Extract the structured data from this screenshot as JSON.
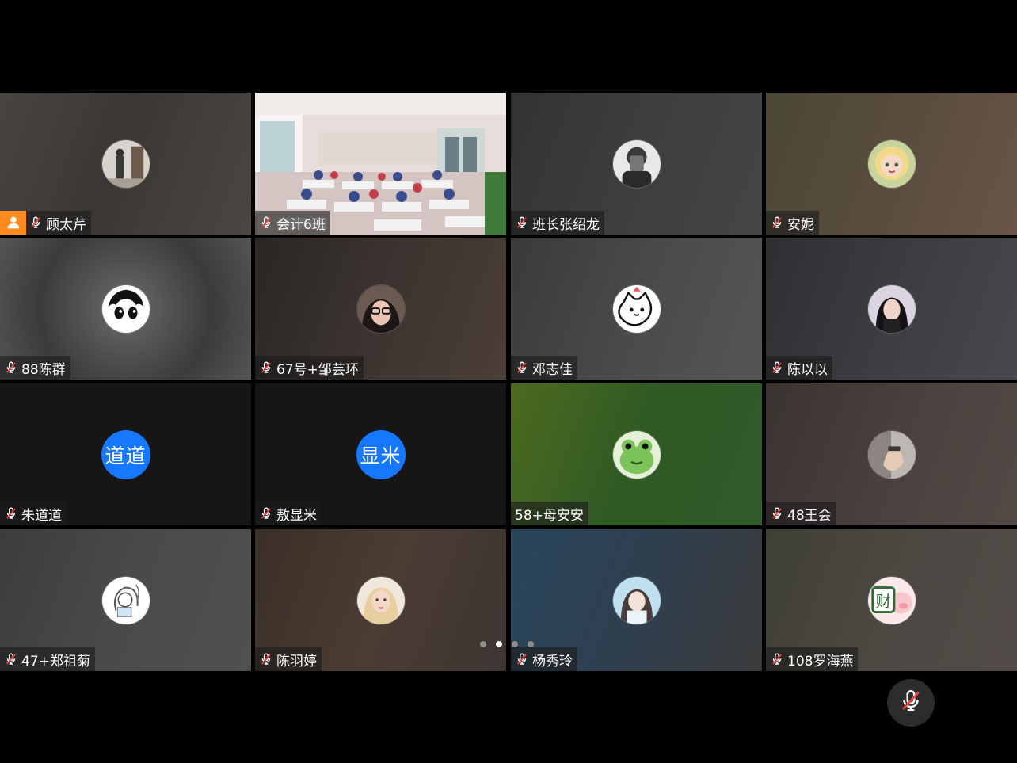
{
  "app": {
    "colors": {
      "host_badge": "#ff8a1f",
      "text_avatar": "#1677ff",
      "mute_slash": "#e8453c"
    }
  },
  "grid": {
    "participants": [
      {
        "name": "顾太芹",
        "muted": true,
        "host": true,
        "avatar_type": "photo",
        "avatar_icon": "person-photo-icon",
        "bg": "linear-gradient(110deg,#4a443f 0%,#3a3734 45%,#4c4641 100%)"
      },
      {
        "name": "会计6班",
        "muted": true,
        "host": false,
        "avatar_type": "video",
        "avatar_icon": "classroom-video-icon",
        "bg": ""
      },
      {
        "name": "班长张绍龙",
        "muted": true,
        "host": false,
        "avatar_type": "photo",
        "avatar_icon": "selfie-photo-icon",
        "bg": "linear-gradient(110deg,#333 0%,#3e3e3e 50%,#454545 100%)"
      },
      {
        "name": "安妮",
        "muted": true,
        "host": false,
        "avatar_type": "photo",
        "avatar_icon": "anime-girl-photo-icon",
        "bg": "linear-gradient(110deg,#4a4736 0%,#5a4d40 55%,#6a5547 100%)"
      },
      {
        "name": "88陈群",
        "muted": true,
        "host": false,
        "avatar_type": "photo",
        "avatar_icon": "cartoon-face-icon",
        "bg": "radial-gradient(circle at 50% 50%,#6b6b6b 0%,#3b3b3b 60%,#555 100%)"
      },
      {
        "name": "67号+邹芸环",
        "muted": true,
        "host": false,
        "avatar_type": "photo",
        "avatar_icon": "glasses-girl-photo-icon",
        "bg": "linear-gradient(110deg,#2a2623 0%,#3c3430 50%,#4b3d38 100%)"
      },
      {
        "name": "邓志佳",
        "muted": true,
        "host": false,
        "avatar_type": "photo",
        "avatar_icon": "cartoon-cat-icon",
        "bg": "linear-gradient(110deg,#3a3a3a 0%,#4a4a4a 50%,#555 100%)"
      },
      {
        "name": "陈以以",
        "muted": true,
        "host": false,
        "avatar_type": "photo",
        "avatar_icon": "girl-photo-icon",
        "bg": "linear-gradient(110deg,#2e2f33 0%,#3c3d41 50%,#47484c 100%)"
      },
      {
        "name": "朱道道",
        "muted": true,
        "host": false,
        "avatar_type": "text",
        "avatar_text": "道道",
        "bg": "#161616"
      },
      {
        "name": "敖显米",
        "muted": true,
        "host": false,
        "avatar_type": "text",
        "avatar_text": "显米",
        "bg": "#161616"
      },
      {
        "name": "58+母安安",
        "muted": false,
        "host": false,
        "avatar_type": "photo",
        "avatar_icon": "frog-avatar-icon",
        "bg": "linear-gradient(110deg,#4c6a1f 0%,#2f5a24 50%,#2f5c2b 100%)"
      },
      {
        "name": "48王会",
        "muted": true,
        "host": false,
        "avatar_type": "photo",
        "avatar_icon": "hand-photo-icon",
        "bg": "linear-gradient(110deg,#3a3431 0%,#4a403d 50%,#544945 100%)"
      },
      {
        "name": "47+郑祖菊",
        "muted": true,
        "host": false,
        "avatar_type": "photo",
        "avatar_icon": "sketch-girl-icon",
        "bg": "linear-gradient(110deg,#3c3c3c 0%,#4a4a4a 50%,#505050 100%)"
      },
      {
        "name": "陈羽婷",
        "muted": true,
        "host": false,
        "avatar_type": "photo",
        "avatar_icon": "blonde-girl-photo-icon",
        "bg": "linear-gradient(110deg,#3a2f27 0%,#4b3c33 50%,#3c3532 100%)"
      },
      {
        "name": "杨秀玲",
        "muted": true,
        "host": false,
        "avatar_type": "photo",
        "avatar_icon": "anime-blue-girl-icon",
        "bg": "linear-gradient(110deg,#28455a 0%,#2f3f4f 50%,#3b3b3b 100%)"
      },
      {
        "name": "108罗海燕",
        "muted": true,
        "host": false,
        "avatar_type": "photo",
        "avatar_icon": "pig-cai-icon",
        "bg": "linear-gradient(110deg,#3f3f36 0%,#4c4842 50%,#524b47 100%)"
      }
    ]
  },
  "pager": {
    "dot_count": 4,
    "active_index": 1
  },
  "controls": {
    "mic_icon": "mic-off-icon"
  }
}
